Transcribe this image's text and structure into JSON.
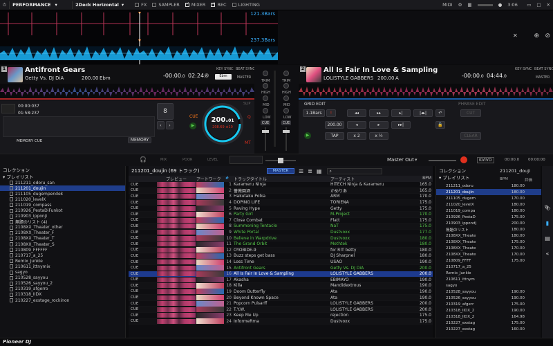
{
  "topbar": {
    "mode": "PERFORMANCE",
    "layout": "2Deck Horizontal",
    "toggles": [
      {
        "label": "FX",
        "on": false
      },
      {
        "label": "SAMPLER",
        "on": false
      },
      {
        "label": "MIXER",
        "on": true
      },
      {
        "label": "REC",
        "on": true
      },
      {
        "label": "LIGHTING",
        "on": false
      }
    ],
    "midi": "MIDI",
    "clock": "3:06"
  },
  "overview": {
    "bars_top": "121.3Bars",
    "bars_bottom": "237.3Bars"
  },
  "deck1": {
    "num": "1",
    "title": "Antifront Gears",
    "artist": "Getty Vs. DJ DiA",
    "bpm": "200.00",
    "key": "Ebm",
    "remain": "-00:00",
    "remain_ms": ".0",
    "elapsed": "02:24",
    "elapsed_ms": ".6",
    "key_sync": "KEY SYNC",
    "key_sync_val": "Ebm",
    "beat_sync": "BEAT SYNC",
    "master": "MASTER",
    "cue_time1": "00:00:037",
    "cue_time2": "01:58:237",
    "beat_jump": "8",
    "jog_bpm": "200.",
    "jog_bpm_dec": "01",
    "jog_sub1": "208.69",
    "jog_sub2": "±10",
    "memory_cue": "MEMORY CUE",
    "memory": "MEMORY",
    "slip": "SLIP",
    "q": "Q",
    "mt": "MT",
    "cue": "CUE"
  },
  "deck2": {
    "num": "2",
    "title": "All Is Fair In Love & Sampling",
    "artist": "LOLISTYLE GABBERS",
    "bpm": "200.00",
    "key": "A",
    "remain": "-00:00",
    "remain_ms": ".0",
    "elapsed": "04:44",
    "elapsed_ms": ".0",
    "key_sync": "KEY SYNC",
    "beat_sync": "BEAT SYNC",
    "master": "MASTER",
    "grid_edit": "GRID EDIT",
    "grid_bars": "1.1Bars",
    "grid_bpm": "200.00",
    "tap": "TAP",
    "x2": "x 2",
    "half": "x ½",
    "phrase_edit": "PHRASE EDIT",
    "cut": "CUT",
    "clear": "CLEAR"
  },
  "mixer": {
    "trim": "TRIM",
    "hi": "HIGH",
    "mid": "MID",
    "low": "LOW",
    "cue": "CUE"
  },
  "strip": {
    "master_out": "Master Out",
    "time_a": "00:00.0",
    "time_b": "00:00:00",
    "labels": [
      "MIX",
      "POOR",
      "LEVEL"
    ],
    "brand": "KVIVO"
  },
  "tree": {
    "collection": "コレクション",
    "playlists": "プレイリスト",
    "items": [
      "211211_odoru_san",
      "211201_doujin",
      "211105_dugempendek",
      "211020_levelX",
      "211019_compass",
      "210926_PestaDiFunkot",
      "210903_ipponji",
      "無題のリスト (4)",
      "2108XX_Theater_other",
      "2108XX_Theater_F",
      "2108XX_Theater_T",
      "2108XX_Theater_S",
      "210809_FFFFFF",
      "210717_a_25",
      "Remix_Junkie",
      "210611_ittnymix",
      "sagyo",
      "210528_sayyou",
      "210526_sayyou_2",
      "210319_afgerro",
      "210318_IIDX",
      "210227_exstage_rockinon"
    ],
    "selected": 1
  },
  "list": {
    "title": "211201_doujin (69 トラック)",
    "master": "MASTER",
    "columns": {
      "preview": "プレビュー",
      "artwork": "アートワーク",
      "num": "#",
      "title": "トラックタイトル",
      "artist": "アーティスト",
      "bpm": "BPM"
    },
    "rows": [
      {
        "cue": "CUE",
        "n": "1",
        "t": "Karameru Ninja",
        "a": "HiTECH Ninja & Karameru",
        "b": "165.0",
        "s": ""
      },
      {
        "cue": "CUE",
        "n": "2",
        "t": "薔薇園酒",
        "a": "かめりあ",
        "b": "165.0",
        "s": ""
      },
      {
        "cue": "CUE",
        "n": "3",
        "t": "Hakutaku Polka",
        "a": "ARM",
        "b": "170.0",
        "s": ""
      },
      {
        "cue": "CUE",
        "n": "4",
        "t": "DOPING LIFE",
        "a": "TORIENA",
        "b": "175.0",
        "s": ""
      },
      {
        "cue": "CUE",
        "n": "5",
        "t": "Raving Hype",
        "a": "Getty",
        "b": "175.0",
        "s": ""
      },
      {
        "cue": "CUE",
        "n": "6",
        "t": "Party Girl",
        "a": "M-Project",
        "b": "170.0",
        "s": "playing"
      },
      {
        "cue": "CUE",
        "n": "7",
        "t": "Close Combat",
        "a": "Flatt",
        "b": "175.0",
        "s": ""
      },
      {
        "cue": "CUE",
        "n": "8",
        "t": "Summoning Tentacle",
        "a": "NaT",
        "b": "175.0",
        "s": "playing"
      },
      {
        "cue": "CUE",
        "n": "9",
        "t": "White Portal",
        "a": "Dustvoxx",
        "b": "177.0",
        "s": "playing"
      },
      {
        "cue": "CUE",
        "n": "10",
        "t": "Believe in Warpdrive",
        "a": "Dustvoxx",
        "b": "180.0",
        "s": "playing"
      },
      {
        "cue": "CUE",
        "n": "11",
        "t": "The Grand Orbit",
        "a": "Mothtek",
        "b": "180.0",
        "s": "playing"
      },
      {
        "cue": "CUE",
        "n": "12",
        "t": "OYOBIDE-9",
        "a": "for RIT betty",
        "b": "180.0",
        "s": ""
      },
      {
        "cue": "CUE",
        "n": "13",
        "t": "Buzz steps get bass",
        "a": "DJ Sharpnel",
        "b": "180.0",
        "s": ""
      },
      {
        "cue": "CUE",
        "n": "14",
        "t": "Loss Time",
        "a": "USAO",
        "b": "190.0",
        "s": ""
      },
      {
        "cue": "CUE",
        "n": "15",
        "t": "Antifront Gears",
        "a": "Getty Vs. DJ DiA",
        "b": "200.0",
        "s": "playing"
      },
      {
        "cue": "CUE",
        "n": "16",
        "t": "All Is Fair In Love & Sampling",
        "a": "LOLISTYLE GABBERS",
        "b": "200.0",
        "s": "sel"
      },
      {
        "cue": "CUE",
        "n": "17",
        "t": "Akasha",
        "a": "EBIMAYO",
        "b": "190.0",
        "s": ""
      },
      {
        "cue": "CUE",
        "n": "18",
        "t": "Killa",
        "a": "Mandidextrous",
        "b": "190.0",
        "s": ""
      },
      {
        "cue": "CUE",
        "n": "19",
        "t": "Doom Butterfly",
        "a": "Ata",
        "b": "190.0",
        "s": ""
      },
      {
        "cue": "CUE",
        "n": "20",
        "t": "Beyond Known Space",
        "a": "Ata",
        "b": "190.0",
        "s": ""
      },
      {
        "cue": "CUE",
        "n": "21",
        "t": "Popcorn Pulsarff",
        "a": "LOLISTYLE GABBERS",
        "b": "200.0",
        "s": ""
      },
      {
        "cue": "CUE",
        "n": "22",
        "t": "T.Y.W.",
        "a": "LOLISTYLE GABBERS",
        "b": "200.0",
        "s": ""
      },
      {
        "cue": "CUE",
        "n": "23",
        "t": "Keep Me Up",
        "a": "rejection",
        "b": "175.0",
        "s": ""
      },
      {
        "cue": "CUE",
        "n": "24",
        "t": "InformeRma",
        "a": "Dustvoxx",
        "b": "175.0",
        "s": ""
      }
    ]
  },
  "right": {
    "collection": "コレクション",
    "playlists": "プレイリスト",
    "header": "211201_douji",
    "col_bpm": "BPM",
    "col_rating": "評価",
    "items": [
      "211211_odoru",
      "211201_doujin",
      "211105_dugem",
      "211020_levelX",
      "211019_compa",
      "210926_PestaD",
      "210903_ippondj",
      "無題のリスト",
      "2108XX_Theate",
      "2108XX_Theate",
      "2108XX_Theate",
      "2108XX_Theate",
      "210809_FFFF",
      "210717_a_25",
      "Remix_Junkie",
      "210611_ittnym",
      "sagyo",
      "210528_sayyou",
      "210526_sayyou",
      "210319_afgerr",
      "210318_IIDX_2",
      "210318_IIDX_2",
      "210227_exstag",
      "210227_exstag"
    ],
    "bpms": [
      "180.00",
      "180.00",
      "170.00",
      "180.00",
      "180.00",
      "175.00",
      "200.00",
      "180.00",
      "180.00",
      "175.00",
      "170.00",
      "170.00",
      "175.00",
      "",
      "",
      "",
      "",
      "190.00",
      "190.00",
      "175.00",
      "190.00",
      "164.98",
      "175.00",
      "160.00"
    ],
    "selected": 1
  },
  "bottom": {
    "brand": "Pioneer DJ"
  },
  "colors": {
    "accent": "#1f3d8a",
    "green": "#57c84a",
    "orange": "#ff7a1a",
    "red": "#e0301e",
    "cyan": "#18c8f0"
  }
}
